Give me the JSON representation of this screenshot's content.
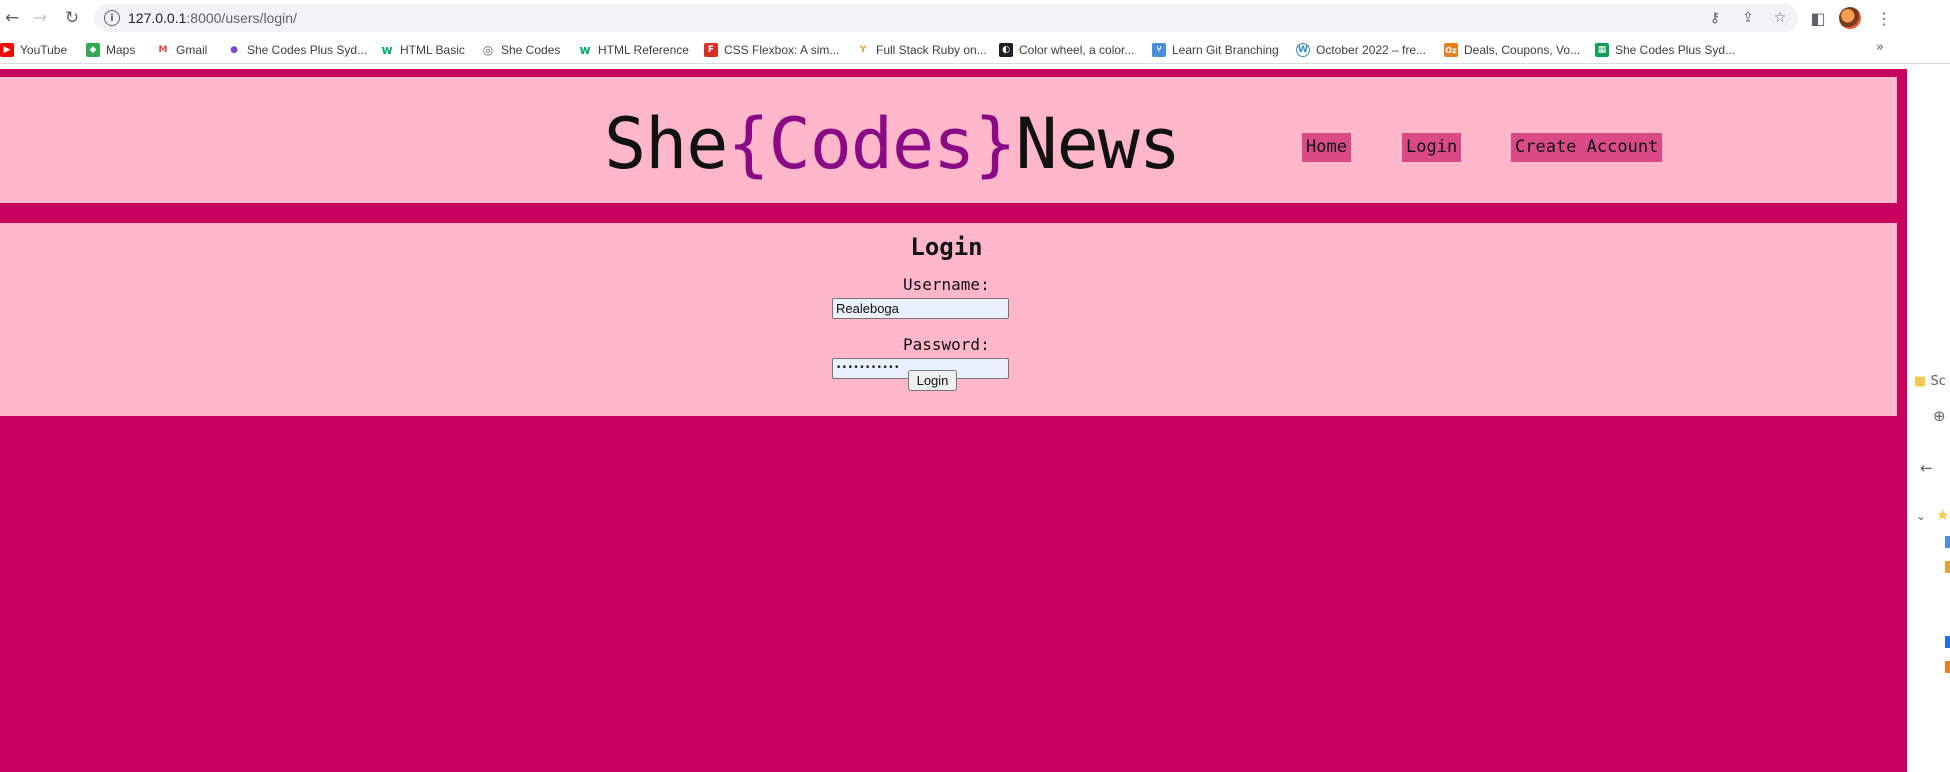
{
  "browser": {
    "url_host": "127.0.0.1",
    "url_path": ":8000/users/login/",
    "bookmarks": [
      {
        "label": "YouTube",
        "icon": "youtube-icon",
        "color": "#ff0000",
        "glyph": "▶"
      },
      {
        "label": "Maps",
        "icon": "maps-icon",
        "color": "#34a853",
        "glyph": "◆"
      },
      {
        "label": "Gmail",
        "icon": "gmail-icon",
        "color": "#ea4335",
        "glyph": "M"
      },
      {
        "label": "She Codes Plus Syd...",
        "icon": "shecodes-icon",
        "color": "#7b4fc9",
        "glyph": "●"
      },
      {
        "label": "HTML Basic",
        "icon": "w3schools-icon",
        "color": "#04aa6d",
        "glyph": "w"
      },
      {
        "label": "She Codes",
        "icon": "globe-icon",
        "color": "#5f6368",
        "glyph": "◎"
      },
      {
        "label": "HTML Reference",
        "icon": "w3schools-icon",
        "color": "#04aa6d",
        "glyph": "w"
      },
      {
        "label": "CSS Flexbox: A sim...",
        "icon": "flexbox-icon",
        "color": "#d93025",
        "glyph": "F"
      },
      {
        "label": "Full Stack Ruby on...",
        "icon": "ruby-icon",
        "color": "#e8a13a",
        "glyph": "Y"
      },
      {
        "label": "Color wheel, a color...",
        "icon": "color-wheel-icon",
        "color": "#202124",
        "glyph": "◐"
      },
      {
        "label": "Learn Git Branching",
        "icon": "git-icon",
        "color": "#4a8fd8",
        "glyph": "⑂"
      },
      {
        "label": "October 2022 – fre...",
        "icon": "wordpress-icon",
        "color": "#3a86c8",
        "glyph": "W"
      },
      {
        "label": "Deals, Coupons, Vo...",
        "icon": "ozbargain-icon",
        "color": "#e67e22",
        "glyph": "Oz"
      },
      {
        "label": "She Codes Plus Syd...",
        "icon": "sheets-icon",
        "color": "#0f9d58",
        "glyph": "▦"
      }
    ]
  },
  "site": {
    "logo_she": "She",
    "logo_codes": "{Codes}",
    "logo_news": "News",
    "nav": {
      "home": "Home",
      "login": "Login",
      "create_account": "Create Account"
    }
  },
  "login": {
    "heading": "Login",
    "username_label": "Username:",
    "username_value": "Realeboga",
    "password_label": "Password:",
    "password_value": "•••••••••••",
    "submit_label": "Login"
  },
  "side_panel": {
    "item_label": "Sc"
  },
  "colors": {
    "page_bg": "#c9005d",
    "panel_bg": "#ffb7c9",
    "nav_bg": "#d94a86",
    "logo_accent": "#8a0a86"
  }
}
